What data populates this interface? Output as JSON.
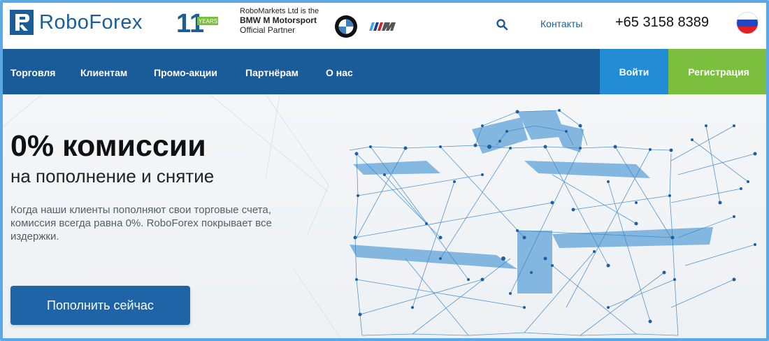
{
  "header": {
    "logo_text": "RoboForex",
    "years_text": "YEARS",
    "partner_line1": "RoboMarkets Ltd is the",
    "partner_line2": "BMW M Motorsport",
    "partner_line3": "Official Partner",
    "contacts": "Контакты",
    "phone": "+65 3158 8389",
    "icons": [
      "roboforex-logo-icon",
      "anniversary-11-years-icon",
      "bmw-logo-icon",
      "bmw-m-logo-icon",
      "search-icon",
      "russia-flag-icon"
    ]
  },
  "nav": {
    "items": [
      "Торговля",
      "Клиентам",
      "Промо-акции",
      "Партнёрам",
      "О нас"
    ],
    "login": "Войти",
    "register": "Регистрация"
  },
  "hero": {
    "title": "0% комиссии",
    "subtitle": "на пополнение и снятие",
    "description": "Когда наши клиенты пополняют свои торговые счета, комиссия всегда равна 0%. RoboForex покрывает все издержки.",
    "cta": "Пополнить сейчас"
  },
  "colors": {
    "brand_blue": "#1a5c9a",
    "login_blue": "#228cd4",
    "register_green": "#7cbf3f",
    "cta_blue": "#1e64a6"
  }
}
